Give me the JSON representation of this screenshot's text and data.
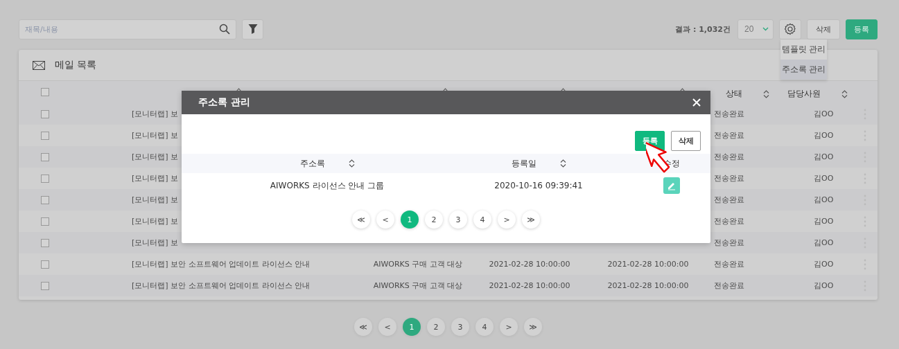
{
  "toolbar": {
    "search": {
      "placeholder": "재목/내용"
    },
    "result": "결과 : 1,032건",
    "page_size": "20",
    "buttons": [
      {
        "label": "삭제",
        "kind": "plain"
      },
      {
        "label": "등록",
        "kind": "primary"
      }
    ]
  },
  "settings_menu": {
    "items": [
      {
        "label": "템플릿 관리",
        "selected": false
      },
      {
        "label": "주소록 관리",
        "selected": true
      }
    ]
  },
  "mail_list": {
    "title": "메일 목록",
    "header_checked": false,
    "columns": [
      {
        "kind": "asc"
      },
      {
        "kind": "asc"
      },
      {
        "kind": "asc"
      },
      {
        "kind": "asc"
      },
      {
        "label": "상태",
        "kind": "both"
      },
      {
        "label": "담당사원",
        "kind": "both"
      }
    ],
    "rows": [
      {
        "checked": false,
        "title": "[모니터랩] 보",
        "status": "전송완료",
        "owner": "김OO"
      },
      {
        "checked": false,
        "title": "[모니터랩] 보",
        "status": "전송완료",
        "owner": "김OO"
      },
      {
        "checked": false,
        "title": "[모니터랩] 보",
        "status": "전송완료",
        "owner": "김OO"
      },
      {
        "checked": false,
        "title": "[모니터랩] 보",
        "status": "전송완료",
        "owner": "김OO"
      },
      {
        "checked": false,
        "title": "[모니터랩] 보",
        "status": "전송완료",
        "owner": "김OO"
      },
      {
        "checked": false,
        "title": "[모니터랩] 보",
        "status": "전송완료",
        "owner": "김OO"
      },
      {
        "checked": false,
        "title": "[모니터랩] 보",
        "status": "전송완료",
        "owner": "김OO"
      },
      {
        "checked": false,
        "title": "[모니터랩] 보안 소프트웨어 업데이트 라이선스 안내",
        "campaign": "AIWORKS 구매 고객 대상",
        "end_date": "2021-02-28 10:00:00",
        "sent_date": "2021-02-28 10:00:00",
        "status": "전송완료",
        "owner": "김OO"
      },
      {
        "checked": false,
        "title": "[모니터랩] 보안 소프트웨어 업데이트 라이선스 안내",
        "campaign": "AIWORKS 구매 고객 대상",
        "end_date": "2021-02-28 10:00:00",
        "sent_date": "2021-02-28 10:00:00",
        "status": "전송완료",
        "owner": "김OO"
      }
    ]
  },
  "pagination": [
    {
      "label": "≪",
      "selected": false
    },
    {
      "label": "<",
      "selected": false
    },
    {
      "label": "1",
      "selected": true
    },
    {
      "label": "2",
      "selected": false
    },
    {
      "label": "3",
      "selected": false
    },
    {
      "label": "4",
      "selected": false
    },
    {
      "label": ">",
      "selected": false
    },
    {
      "label": "≫",
      "selected": false
    }
  ],
  "modal": {
    "title": "주소록 관리",
    "buttons": [
      {
        "label": "등록",
        "kind": "primary"
      },
      {
        "label": "삭제",
        "kind": "plain"
      }
    ],
    "columns": [
      {
        "label": "주소록",
        "kind": "both"
      },
      {
        "label": "등록일",
        "kind": "both"
      },
      {
        "label": "수정",
        "kind": "plain"
      }
    ],
    "rows": [
      {
        "name": "AIWORKS 라이선스 안내 그룹",
        "date": "2020-10-16 09:39:41"
      }
    ],
    "pagination": [
      {
        "label": "≪",
        "selected": false
      },
      {
        "label": "<",
        "selected": false
      },
      {
        "label": "1",
        "selected": true
      },
      {
        "label": "2",
        "selected": false
      },
      {
        "label": "3",
        "selected": false
      },
      {
        "label": "4",
        "selected": false
      },
      {
        "label": ">",
        "selected": false
      },
      {
        "label": "≫",
        "selected": false
      }
    ]
  }
}
